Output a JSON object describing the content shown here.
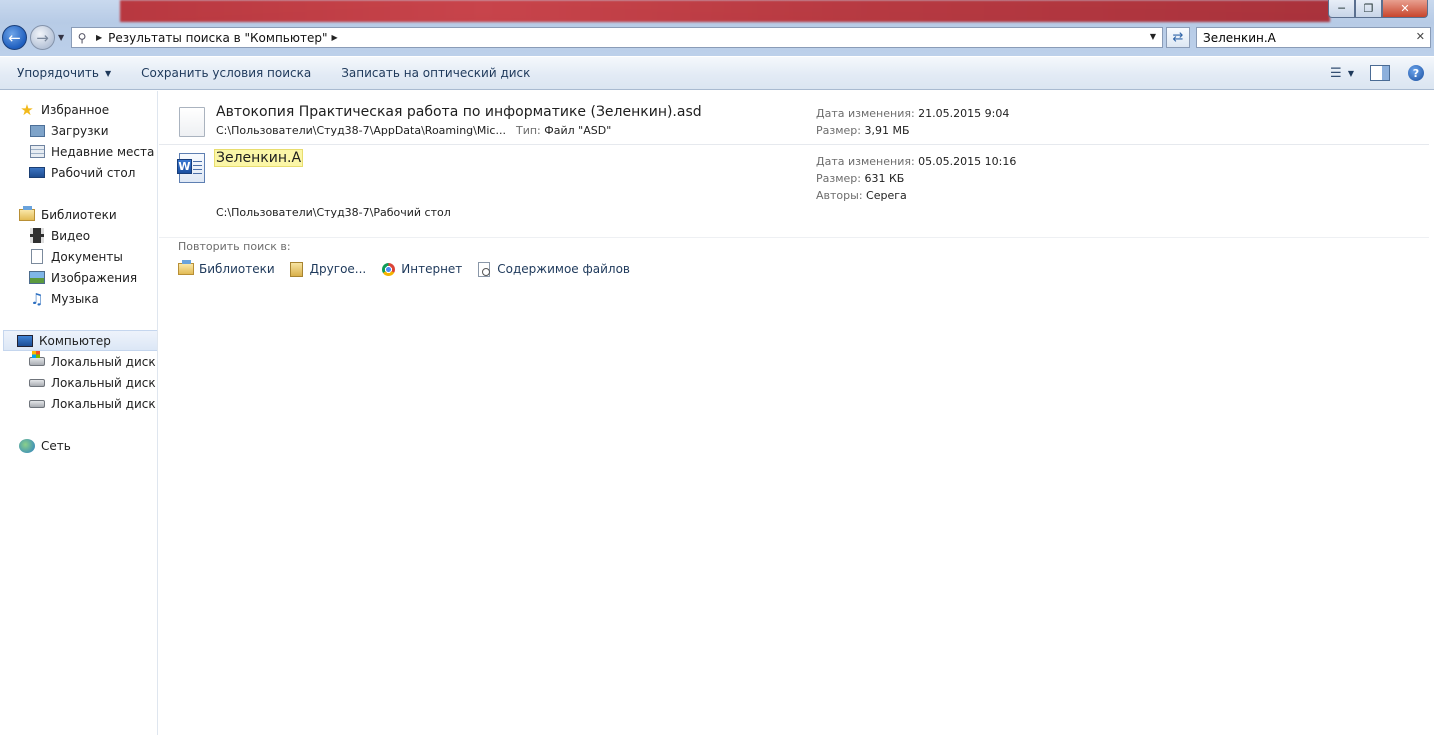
{
  "window": {
    "minimize_glyph": "─",
    "maximize_glyph": "❐",
    "close_glyph": "✕"
  },
  "address_bar": {
    "breadcrumb": "Результаты поиска в \"Компьютер\""
  },
  "search": {
    "value": "Зеленкин.А"
  },
  "toolbar": {
    "organize_label": "Упорядочить",
    "save_search_label": "Сохранить условия поиска",
    "burn_label": "Записать на оптический диск"
  },
  "navigation": {
    "favorites": {
      "label": "Избранное",
      "items": [
        "Загрузки",
        "Недавние места",
        "Рабочий стол"
      ]
    },
    "libraries": {
      "label": "Библиотеки",
      "items": [
        "Видео",
        "Документы",
        "Изображения",
        "Музыка"
      ]
    },
    "computer": {
      "label": "Компьютер",
      "items": [
        "Локальный диск (C:)",
        "Локальный диск (D:)",
        "Локальный диск (F:)"
      ]
    },
    "network": {
      "label": "Сеть"
    }
  },
  "results": [
    {
      "name": "Автокопия Практическая работа по информатике (Зеленкин).asd",
      "path": "C:\\Пользователи\\Студ38-7\\AppData\\Roaming\\Mic...",
      "type_label": "Тип:",
      "type_value": "Файл \"ASD\"",
      "date_label": "Дата изменения:",
      "date_value": "21.05.2015 9:04",
      "size_label": "Размер:",
      "size_value": "3,91 МБ",
      "icon": "blank-file-icon"
    },
    {
      "name": "Зеленкин.А",
      "path": "C:\\Пользователи\\Студ38-7\\Рабочий стол",
      "date_label": "Дата изменения:",
      "date_value": "05.05.2015 10:16",
      "size_label": "Размер:",
      "size_value": "631 КБ",
      "authors_label": "Авторы:",
      "authors_value": "Серега",
      "icon": "word-document-icon",
      "highlight_color": "#fbf6a7"
    }
  ],
  "search_again": {
    "label": "Повторить поиск в:",
    "items": [
      "Библиотеки",
      "Другое...",
      "Интернет",
      "Содержимое файлов"
    ]
  }
}
